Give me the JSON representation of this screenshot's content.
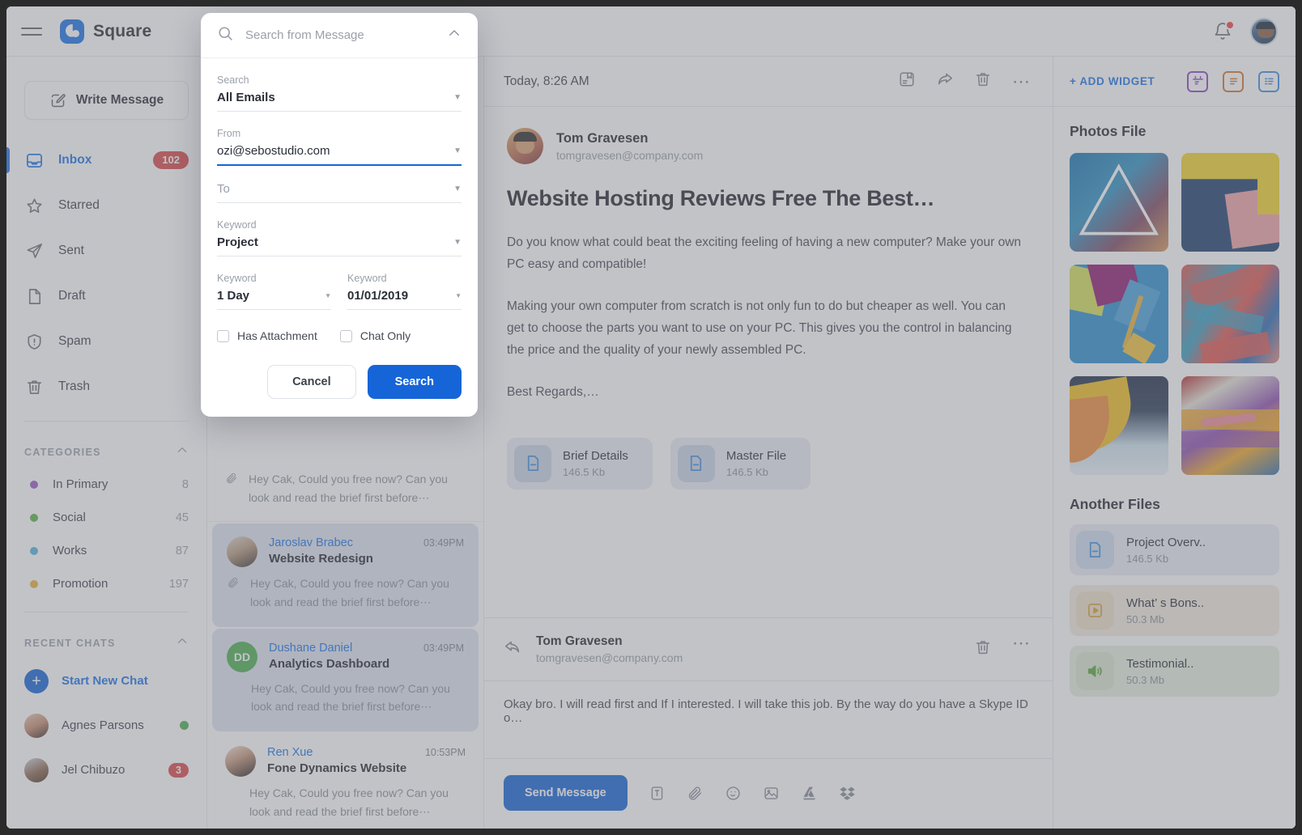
{
  "app": {
    "brand": "Square"
  },
  "topbar": {
    "menu_icon": "hamburger-icon",
    "logo_icon": "square-logo-icon",
    "bell_icon": "notification-bell-icon",
    "avatar_icon": "user-avatar"
  },
  "sidebar": {
    "write_label": "Write Message",
    "nav": [
      {
        "label": "Inbox",
        "badge": "102",
        "icon": "inbox-icon",
        "active": true
      },
      {
        "label": "Starred",
        "badge": "",
        "icon": "star-icon",
        "active": false
      },
      {
        "label": "Sent",
        "badge": "",
        "icon": "paper-plane-icon",
        "active": false
      },
      {
        "label": "Draft",
        "badge": "",
        "icon": "document-icon",
        "active": false
      },
      {
        "label": "Spam",
        "badge": "",
        "icon": "shield-alert-icon",
        "active": false
      },
      {
        "label": "Trash",
        "badge": "",
        "icon": "trash-icon",
        "active": false
      }
    ],
    "categories_header": "CATEGORIES",
    "categories": [
      {
        "label": "In Primary",
        "count": "8",
        "color": "#9b5cc8"
      },
      {
        "label": "Social",
        "count": "45",
        "color": "#5eb34a"
      },
      {
        "label": "Works",
        "count": "87",
        "color": "#54b4e0"
      },
      {
        "label": "Promotion",
        "count": "197",
        "color": "#e8b23c"
      }
    ],
    "recent_header": "RECENT CHATS",
    "start_chat": "Start New Chat",
    "chats": [
      {
        "name": "Agnes Parsons",
        "status": "online",
        "badge": ""
      },
      {
        "name": "Jel Chibuzo",
        "status": "",
        "badge": "3"
      }
    ]
  },
  "mail_list": [
    {
      "name": "",
      "time": "",
      "subject": "",
      "preview": "Hey Cak, Could you free now? Can you look and read the brief first before⋯",
      "has_attachment": true,
      "selected": false,
      "partial": true
    },
    {
      "name": "Jaroslav Brabec",
      "time": "03:49PM",
      "subject": "Website Redesign",
      "preview": "Hey Cak, Could you free now? Can you look and read the brief first before⋯",
      "has_attachment": true,
      "selected": true,
      "avatar_type": "photo-male"
    },
    {
      "name": "Dushane Daniel",
      "time": "03:49PM",
      "subject": "Analytics Dashboard",
      "preview": "Hey Cak, Could you free now? Can you look and read the brief first before⋯",
      "has_attachment": false,
      "selected": true,
      "avatar_type": "initials",
      "initials": "DD",
      "avatar_color": "#4caf50"
    },
    {
      "name": "Ren Xue",
      "time": "10:53PM",
      "subject": "Fone Dynamics Website",
      "preview": "Hey Cak, Could you free now? Can you look and read the brief first before⋯",
      "has_attachment": false,
      "selected": false,
      "avatar_type": "photo-female"
    }
  ],
  "message": {
    "date": "Today, 8:26 AM",
    "actions": [
      "archive-icon",
      "forward-icon",
      "trash-icon",
      "more-icon"
    ],
    "sender_name": "Tom Gravesen",
    "sender_email": "tomgravesen@company.com",
    "title": "Website Hosting Reviews Free The Best…",
    "paragraph1": "Do you know what could beat the exciting feeling of having a new computer? Make your own PC easy and compatible!",
    "paragraph2": "Making your own computer from scratch is not only fun to do but cheaper as well. You can get to choose the parts you want to use on your PC. This gives you the control in balancing the price and the quality of your newly assembled PC.",
    "signoff": "Best Regards,…",
    "attachments": [
      {
        "name": "Brief Details",
        "size": "146.5 Kb",
        "icon": "file-doc-icon"
      },
      {
        "name": "Master File",
        "size": "146.5 Kb",
        "icon": "file-doc-icon"
      }
    ],
    "reply": {
      "name": "Tom Gravesen",
      "email": "tomgravesen@company.com",
      "text": "Okay bro. I will read first and If I interested. I will take this job. By the way do you have a Skype ID o…"
    },
    "compose": {
      "send_label": "Send Message",
      "icons": [
        "text-format-icon",
        "attachment-clip-icon",
        "emoji-icon",
        "image-icon",
        "google-drive-icon",
        "dropbox-icon"
      ]
    }
  },
  "right_panel": {
    "add_widget": "+ ADD WIDGET",
    "widget_icons": [
      {
        "name": "calendar-widget-icon",
        "color": "#8e44c4"
      },
      {
        "name": "notes-widget-icon",
        "color": "#d4762a"
      },
      {
        "name": "tasks-widget-icon",
        "color": "#3f8fe0"
      }
    ],
    "photos_title": "Photos File",
    "photos": [
      "mural-triangle-figure",
      "yellow-navy-pink-wall",
      "blue-desk-pencil-paper",
      "colorful-abstract-mural",
      "yellow-orange-curled-paper",
      "brick-wall-graffiti"
    ],
    "files_title": "Another Files",
    "files": [
      {
        "name": "Project Overv..",
        "size": "146.5 Kb",
        "icon": "file-doc-icon",
        "tint": "#cddcee",
        "color": "#3f8fe0"
      },
      {
        "name": "What’ s Bons..",
        "size": "50.3 Mb",
        "icon": "file-video-icon",
        "tint": "#eee0c9",
        "color": "#d9a336"
      },
      {
        "name": "Testimonial..",
        "size": "50.3 Mb",
        "icon": "file-audio-icon",
        "tint": "#d9e6cf",
        "color": "#5ca63c"
      }
    ]
  },
  "search_modal": {
    "placeholder": "Search from Message",
    "collapse_icon": "chevron-up-icon",
    "search_icon": "search-icon",
    "fields": [
      {
        "label": "Search",
        "value": "All Emails",
        "placeholder": "",
        "focused": false
      },
      {
        "label": "From",
        "value": "ozi@sebostudio.com",
        "placeholder": "",
        "focused": true
      },
      {
        "label": "To",
        "value": "",
        "placeholder": "To",
        "focused": false
      },
      {
        "label": "Keyword",
        "value": "Project",
        "placeholder": "",
        "focused": false
      }
    ],
    "row_fields": [
      {
        "label": "Keyword",
        "value": "1 Day"
      },
      {
        "label": "Keyword",
        "value": "01/01/2019"
      }
    ],
    "checkboxes": [
      {
        "label": "Has Attachment",
        "checked": false
      },
      {
        "label": "Chat Only",
        "checked": false
      }
    ],
    "cancel_label": "Cancel",
    "search_label": "Search"
  }
}
